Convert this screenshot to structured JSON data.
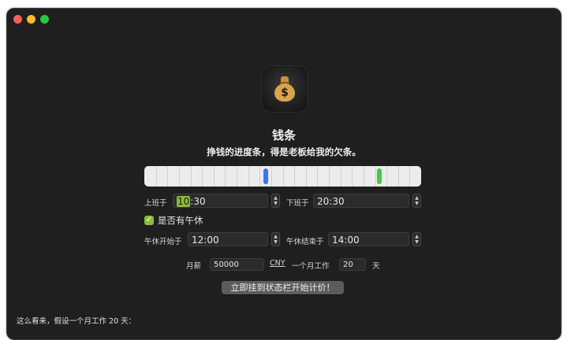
{
  "app": {
    "title": "钱条",
    "subtitle": "挣钱的进度条，得是老板给我的欠条。",
    "icon": "money-bag-icon"
  },
  "progress": {
    "current_fraction": 0.44,
    "end_fraction": 0.85
  },
  "work_start": {
    "label": "上班于",
    "value_highlight": "10",
    "value_rest": ":30"
  },
  "work_end": {
    "label": "下班于",
    "value": "20:30"
  },
  "lunch": {
    "checkbox_label": "是否有午休",
    "checked": true
  },
  "lunch_start": {
    "label": "午休开始于",
    "value": "12:00"
  },
  "lunch_end": {
    "label": "午休结束于",
    "value": "14:00"
  },
  "salary": {
    "label": "月薪",
    "value": "50000",
    "currency": "CNY",
    "workdays_label": "一个月工作",
    "workdays_value": "20",
    "workdays_unit": "天"
  },
  "start_button": {
    "label": "立即挂到状态栏开始计价！"
  },
  "summary": {
    "text": "这么看来，假设一个月工作 20 天："
  },
  "colors": {
    "window_bg": "#1f1f1f",
    "marker_now": "#3478f6",
    "marker_end": "#4cc44f",
    "highlight": "#8fba3c"
  }
}
